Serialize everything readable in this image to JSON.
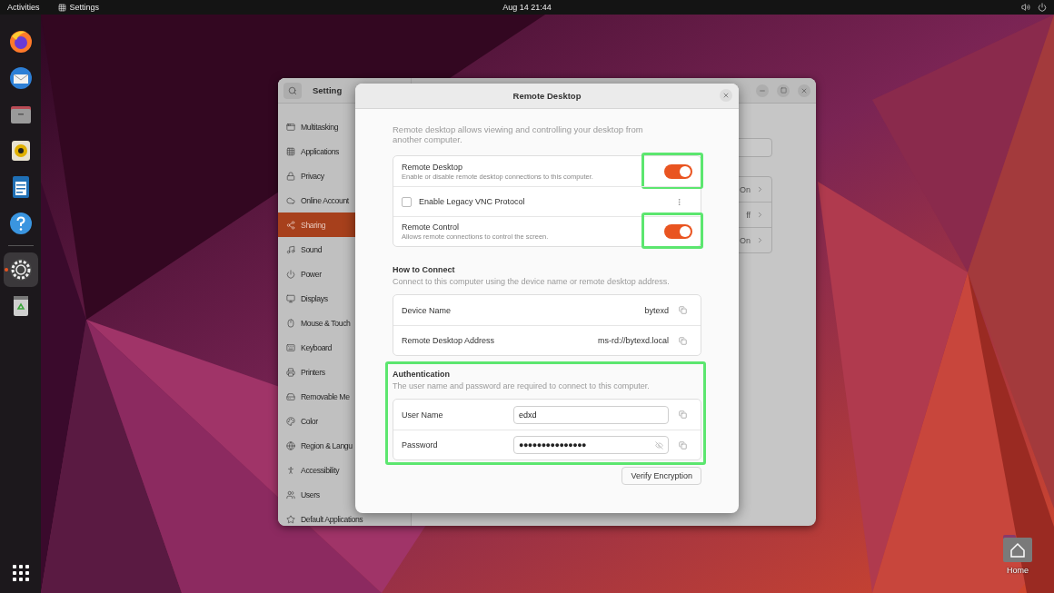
{
  "top_bar": {
    "activities": "Activities",
    "app_menu": "Settings",
    "clock": "Aug 14  21:44"
  },
  "dock": {
    "items": [
      {
        "selected": false
      },
      {
        "selected": false
      },
      {
        "selected": false
      },
      {
        "selected": false
      },
      {
        "selected": false
      },
      {
        "selected": false
      },
      {
        "selected": true
      },
      {
        "selected": false
      }
    ]
  },
  "desktop_icons": [
    {
      "label": "Home"
    }
  ],
  "settings_window": {
    "title": "Setting",
    "sidebar": {
      "items": [
        {
          "label": "Multitasking",
          "selected": false
        },
        {
          "label": "Applications",
          "selected": false
        },
        {
          "label": "Privacy",
          "selected": false
        },
        {
          "label": "Online Account",
          "selected": false
        },
        {
          "label": "Sharing",
          "selected": true
        },
        {
          "label": "Sound",
          "selected": false
        },
        {
          "label": "Power",
          "selected": false
        },
        {
          "label": "Displays",
          "selected": false
        },
        {
          "label": "Mouse & Touch",
          "selected": false
        },
        {
          "label": "Keyboard",
          "selected": false
        },
        {
          "label": "Printers",
          "selected": false
        },
        {
          "label": "Removable Me",
          "selected": false
        },
        {
          "label": "Color",
          "selected": false
        },
        {
          "label": "Region & Langu",
          "selected": false
        },
        {
          "label": "Accessibility",
          "selected": false
        },
        {
          "label": "Users",
          "selected": false
        },
        {
          "label": "Default Applications",
          "selected": false
        }
      ]
    },
    "rows": [
      {
        "value": "On"
      },
      {
        "value": "ff"
      },
      {
        "value": "On"
      }
    ]
  },
  "dialog": {
    "title": "Remote Desktop",
    "intro": "Remote desktop allows viewing and controlling your desktop from another computer.",
    "options": [
      {
        "kind": "switch",
        "title": "Remote Desktop",
        "subtitle": "Enable or disable remote desktop connections to this computer.",
        "on": true,
        "highlighted": true
      },
      {
        "kind": "checkbox",
        "label": "Enable Legacy VNC Protocol",
        "checked": false
      },
      {
        "kind": "switch",
        "title": "Remote Control",
        "subtitle": "Allows remote connections to control the screen.",
        "on": true,
        "highlighted": true
      }
    ],
    "how_to_connect": {
      "heading": "How to Connect",
      "description": "Connect to this computer using the device name or remote desktop address.",
      "rows": [
        {
          "label": "Device Name",
          "value": "bytexd"
        },
        {
          "label": "Remote Desktop Address",
          "value": "ms-rd://bytexd.local"
        }
      ]
    },
    "authentication": {
      "heading": "Authentication",
      "description": "The user name and password are required to connect to this computer.",
      "highlighted": true,
      "fields": [
        {
          "label": "User Name",
          "value": "edxd"
        },
        {
          "label": "Password",
          "value": "●●●●●●●●●●●●●●●"
        }
      ]
    },
    "verify_button": "Verify Encryption"
  }
}
